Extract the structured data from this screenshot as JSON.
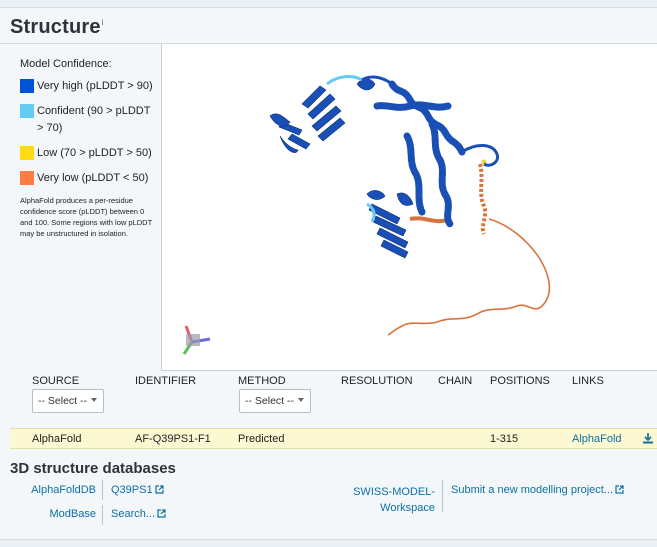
{
  "section": {
    "title": "Structure",
    "info_marker": "i"
  },
  "legend": {
    "heading": "Model Confidence:",
    "items": [
      {
        "label": "Very high (pLDDT > 90)",
        "color": "#0053d6"
      },
      {
        "label": "Confident (90 > pLDDT > 70)",
        "color": "#65cbf3"
      },
      {
        "label": "Low (70 > pLDDT > 50)",
        "color": "#ffdb13"
      },
      {
        "label": "Very low (pLDDT < 50)",
        "color": "#ff7d45"
      }
    ],
    "note": "AlphaFold produces a per-residue confidence score (pLDDT) between 0 and 100. Some regions with low pLDDT may be unstructured in isolation."
  },
  "table": {
    "headers": {
      "source": "SOURCE",
      "identifier": "IDENTIFIER",
      "method": "METHOD",
      "resolution": "RESOLUTION",
      "chain": "CHAIN",
      "positions": "POSITIONS",
      "links": "LINKS"
    },
    "source_select": "-- Select --",
    "method_select": "-- Select --",
    "rows": [
      {
        "source": "AlphaFold",
        "identifier": "AF-Q39PS1-F1",
        "method": "Predicted",
        "resolution": "",
        "chain": "",
        "positions": "1-315",
        "links": "AlphaFold"
      }
    ]
  },
  "databases": {
    "heading": "3D structure databases",
    "entries": [
      {
        "name": "AlphaFoldDB",
        "value": "Q39PS1"
      },
      {
        "name": "ModBase",
        "value": "Search..."
      }
    ],
    "swiss": {
      "name_line1": "SWISS-MODEL-",
      "name_line2": "Workspace",
      "value": "Submit a new modelling project..."
    }
  },
  "colors": {
    "link": "#0b6fa4",
    "highlight_row": "#fbf8d2"
  }
}
